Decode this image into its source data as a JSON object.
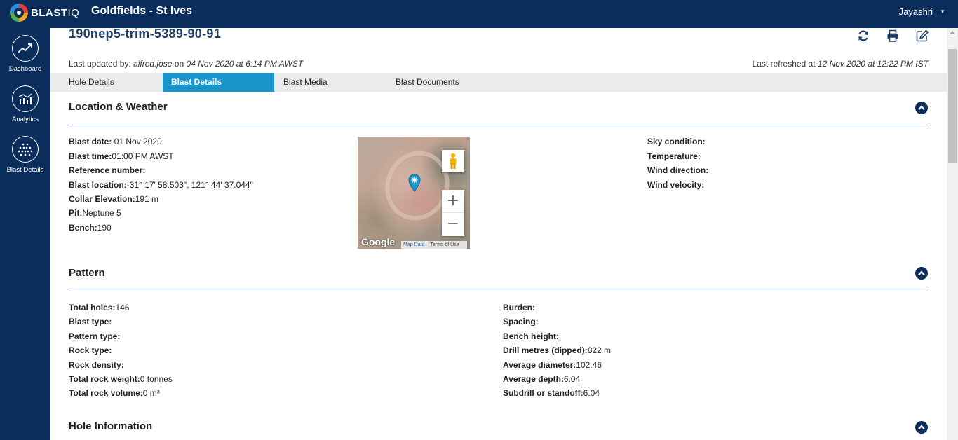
{
  "app": {
    "logo_text": "BLAST",
    "logo_text2": "IQ",
    "site_title": "Goldfields - St Ives",
    "user_name": "Jayashri"
  },
  "sidebar": {
    "items": [
      {
        "label": "Dashboard",
        "icon": "trend-line-icon"
      },
      {
        "label": "Analytics",
        "icon": "bar-chart-icon"
      },
      {
        "label": "Blast Details",
        "icon": "blast-dots-icon"
      }
    ]
  },
  "blast": {
    "title": "190nep5-trim-5389-90-91",
    "updated_prefix": "Last updated by: ",
    "updated_by": "alfred.jose",
    "updated_on_word": " on ",
    "updated_at": "04 Nov 2020 at 6:14 PM AWST",
    "refreshed_prefix": "Last refreshed at ",
    "refreshed_at": "12 Nov 2020 at 12:22 PM IST"
  },
  "tabs": [
    {
      "label": "Hole Details",
      "active": false
    },
    {
      "label": "Blast Details",
      "active": true
    },
    {
      "label": "Blast Media",
      "active": false
    },
    {
      "label": "Blast Documents",
      "active": false
    }
  ],
  "location_weather": {
    "title": "Location & Weather",
    "fields": [
      {
        "label": "Blast date:",
        "value": " 01 Nov 2020"
      },
      {
        "label": "Blast time:",
        "value": "01:00 PM AWST"
      },
      {
        "label": "Reference number:",
        "value": ""
      },
      {
        "label": "Blast location:",
        "value": "-31° 17' 58.503\", 121° 44' 37.044\""
      },
      {
        "label": "Collar Elevation:",
        "value": "191 m"
      },
      {
        "label": "Pit:",
        "value": "Neptune 5"
      },
      {
        "label": "Bench:",
        "value": "190"
      }
    ],
    "weather_fields": [
      {
        "label": "Sky condition:",
        "value": ""
      },
      {
        "label": "Temperature:",
        "value": ""
      },
      {
        "label": "Wind direction:",
        "value": ""
      },
      {
        "label": "Wind velocity:",
        "value": ""
      }
    ],
    "map": {
      "logo": "Google",
      "map_data": "Map Data",
      "terms": "Terms of Use",
      "zoom_in": "+",
      "zoom_out": "−"
    }
  },
  "pattern": {
    "title": "Pattern",
    "left_fields": [
      {
        "label": "Total holes:",
        "value": "146"
      },
      {
        "label": "Blast type:",
        "value": ""
      },
      {
        "label": "Pattern type:",
        "value": ""
      },
      {
        "label": "Rock type:",
        "value": ""
      },
      {
        "label": "Rock density:",
        "value": ""
      },
      {
        "label": "Total rock weight:",
        "value": "0 tonnes"
      },
      {
        "label": "Total rock volume:",
        "value": "0 m³"
      }
    ],
    "right_fields": [
      {
        "label": "Burden:",
        "value": ""
      },
      {
        "label": "Spacing:",
        "value": ""
      },
      {
        "label": "Bench height:",
        "value": ""
      },
      {
        "label": "Drill metres (dipped):",
        "value": "822 m"
      },
      {
        "label": "Average diameter:",
        "value": "102.46"
      },
      {
        "label": "Average depth:",
        "value": "6.04"
      },
      {
        "label": "Subdrill or standoff:",
        "value": "6.04"
      }
    ]
  },
  "hole_information": {
    "title": "Hole Information"
  },
  "colors": {
    "nav_bg": "#0a2d5c",
    "active_tab": "#1b96cd",
    "title_color": "#1f3f66"
  }
}
